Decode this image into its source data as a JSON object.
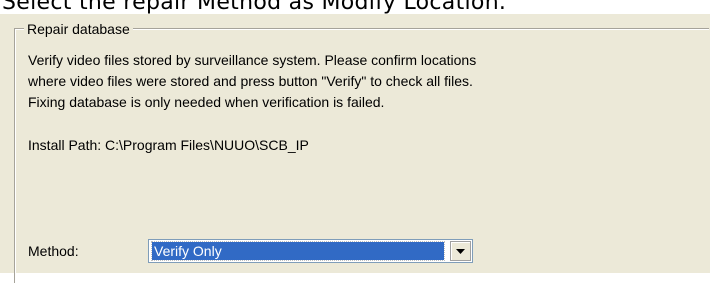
{
  "caption": "Select the repair Method as Modify Location.",
  "groupbox": {
    "title": "Repair database",
    "description_lines": [
      "Verify video files stored by surveillance system. Please confirm locations",
      "where video files were stored and press button \"Verify\" to check all files.",
      "Fixing database is only needed when verification is failed."
    ],
    "install_path": "Install Path: C:\\Program Files\\NUUO\\SCB_IP",
    "method_label": "Method:",
    "method_selected": "Verify Only"
  },
  "icons": {
    "dropdown": "chevron-down-icon"
  }
}
